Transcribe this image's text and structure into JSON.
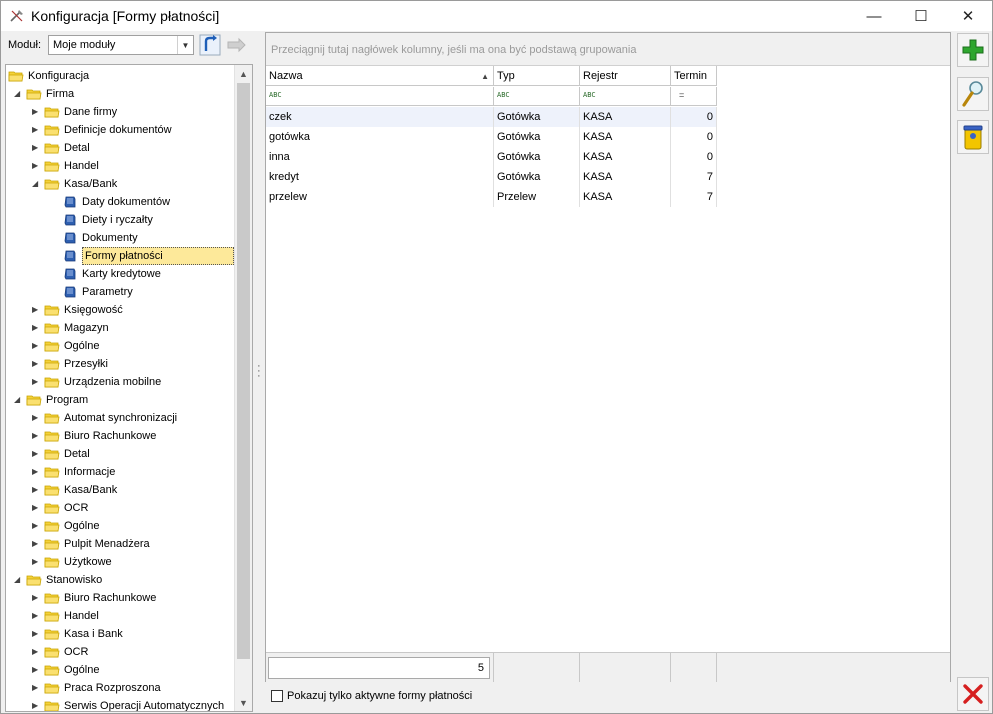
{
  "window": {
    "title": "Konfiguracja [Formy płatności]",
    "min_glyph": "—",
    "max_glyph": "☐",
    "close_glyph": "✕"
  },
  "module": {
    "label": "Moduł:",
    "value": "Moje moduły"
  },
  "tree": {
    "nodes": [
      {
        "label": "Konfiguracja",
        "level": 0,
        "expander": "",
        "icon": "folder-icon"
      },
      {
        "label": "Firma",
        "level": 1,
        "expander": "expanded",
        "icon": "folder-icon"
      },
      {
        "label": "Dane firmy",
        "level": 2,
        "expander": "collapsed",
        "icon": "folder-icon"
      },
      {
        "label": "Definicje dokumentów",
        "level": 2,
        "expander": "collapsed",
        "icon": "folder-icon"
      },
      {
        "label": "Detal",
        "level": 2,
        "expander": "collapsed",
        "icon": "folder-icon"
      },
      {
        "label": "Handel",
        "level": 2,
        "expander": "collapsed",
        "icon": "folder-icon"
      },
      {
        "label": "Kasa/Bank",
        "level": 2,
        "expander": "expanded",
        "icon": "folder-icon"
      },
      {
        "label": "Daty dokumentów",
        "level": 3,
        "expander": "",
        "icon": "page-icon"
      },
      {
        "label": "Diety i ryczałty",
        "level": 3,
        "expander": "",
        "icon": "page-icon"
      },
      {
        "label": "Dokumenty",
        "level": 3,
        "expander": "",
        "icon": "page-icon"
      },
      {
        "label": "Formy płatności",
        "level": 3,
        "expander": "",
        "icon": "page-icon",
        "selected": true
      },
      {
        "label": "Karty kredytowe",
        "level": 3,
        "expander": "",
        "icon": "page-icon"
      },
      {
        "label": "Parametry",
        "level": 3,
        "expander": "",
        "icon": "page-icon"
      },
      {
        "label": "Księgowość",
        "level": 2,
        "expander": "collapsed",
        "icon": "folder-icon"
      },
      {
        "label": "Magazyn",
        "level": 2,
        "expander": "collapsed",
        "icon": "folder-icon"
      },
      {
        "label": "Ogólne",
        "level": 2,
        "expander": "collapsed",
        "icon": "folder-icon"
      },
      {
        "label": "Przesyłki",
        "level": 2,
        "expander": "collapsed",
        "icon": "folder-icon"
      },
      {
        "label": "Urządzenia mobilne",
        "level": 2,
        "expander": "collapsed",
        "icon": "folder-icon"
      },
      {
        "label": "Program",
        "level": 1,
        "expander": "expanded",
        "icon": "folder-icon"
      },
      {
        "label": "Automat synchronizacji",
        "level": 2,
        "expander": "collapsed",
        "icon": "folder-icon"
      },
      {
        "label": "Biuro Rachunkowe",
        "level": 2,
        "expander": "collapsed",
        "icon": "folder-icon"
      },
      {
        "label": "Detal",
        "level": 2,
        "expander": "collapsed",
        "icon": "folder-icon"
      },
      {
        "label": "Informacje",
        "level": 2,
        "expander": "collapsed",
        "icon": "folder-icon"
      },
      {
        "label": "Kasa/Bank",
        "level": 2,
        "expander": "collapsed",
        "icon": "folder-icon"
      },
      {
        "label": "OCR",
        "level": 2,
        "expander": "collapsed",
        "icon": "folder-icon"
      },
      {
        "label": "Ogólne",
        "level": 2,
        "expander": "collapsed",
        "icon": "folder-icon"
      },
      {
        "label": "Pulpit Menadżera",
        "level": 2,
        "expander": "collapsed",
        "icon": "folder-icon"
      },
      {
        "label": "Użytkowe",
        "level": 2,
        "expander": "collapsed",
        "icon": "folder-icon"
      },
      {
        "label": "Stanowisko",
        "level": 1,
        "expander": "expanded",
        "icon": "folder-icon"
      },
      {
        "label": "Biuro Rachunkowe",
        "level": 2,
        "expander": "collapsed",
        "icon": "folder-icon"
      },
      {
        "label": "Handel",
        "level": 2,
        "expander": "collapsed",
        "icon": "folder-icon"
      },
      {
        "label": "Kasa i Bank",
        "level": 2,
        "expander": "collapsed",
        "icon": "folder-icon"
      },
      {
        "label": "OCR",
        "level": 2,
        "expander": "collapsed",
        "icon": "folder-icon"
      },
      {
        "label": "Ogólne",
        "level": 2,
        "expander": "collapsed",
        "icon": "folder-icon"
      },
      {
        "label": "Praca Rozproszona",
        "level": 2,
        "expander": "collapsed",
        "icon": "folder-icon"
      },
      {
        "label": "Serwis Operacji Automatycznych",
        "level": 2,
        "expander": "collapsed",
        "icon": "folder-icon"
      }
    ]
  },
  "grid": {
    "group_hint": "Przeciągnij tutaj nagłówek kolumny, jeśli ma ona być podstawą grupowania",
    "columns": [
      {
        "label": "Nazwa",
        "filter": "text-filter"
      },
      {
        "label": "Typ",
        "filter": "text-filter"
      },
      {
        "label": "Rejestr",
        "filter": "text-filter"
      },
      {
        "label": "Termin",
        "filter": "equals-filter"
      }
    ],
    "filter_text_glyph": "ABC",
    "filter_equals_glyph": "=",
    "rows": [
      [
        "czek",
        "Gotówka",
        "KASA",
        "0"
      ],
      [
        "gotówka",
        "Gotówka",
        "KASA",
        "0"
      ],
      [
        "inna",
        "Gotówka",
        "KASA",
        "0"
      ],
      [
        "kredyt",
        "Gotówka",
        "KASA",
        "7"
      ],
      [
        "przelew",
        "Przelew",
        "KASA",
        "7"
      ]
    ],
    "footer_count": "5"
  },
  "active_only": {
    "label": "Pokazuj tylko aktywne formy płatności",
    "checked": false
  },
  "colors": {
    "selection": "#fde99a",
    "add_green": "#2fa62f",
    "close_red": "#d62020"
  }
}
